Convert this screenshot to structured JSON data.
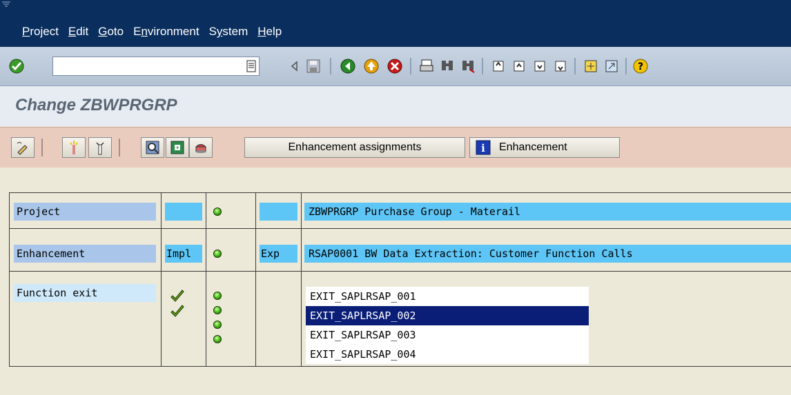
{
  "menu": {
    "items": [
      {
        "u": "P",
        "rest": "roject"
      },
      {
        "u": "E",
        "rest": "dit"
      },
      {
        "u": "G",
        "rest": "oto"
      },
      {
        "u": "",
        "rest": "E",
        "u2": "n",
        "rest2": "vironment"
      },
      {
        "u": "",
        "rest": "S",
        "u2": "y",
        "rest2": "stem"
      },
      {
        "u": "H",
        "rest": "elp"
      }
    ]
  },
  "toolbar": {
    "command_field_value": "",
    "icons": [
      "enter-icon",
      "history-icon",
      "back-arrow-icon",
      "save-icon",
      "back-icon",
      "exit-icon",
      "cancel-icon",
      "print-icon",
      "find-icon",
      "find-next-icon",
      "first-page-icon",
      "previous-page-icon",
      "next-page-icon",
      "last-page-icon",
      "create-session-icon",
      "shortcut-icon",
      "help-icon"
    ]
  },
  "title": "Change ZBWPRGRP",
  "app_toolbar": {
    "enhancement_assignments_label": "Enhancement assignments",
    "enhancement_label": "Enhancement",
    "icons": [
      "display-change-icon",
      "activate-icon",
      "deactivate-icon",
      "where-used-icon",
      "check-icon",
      "documentation-icon"
    ]
  },
  "rows": {
    "project": {
      "label": "Project",
      "impl": "",
      "exp": "",
      "text": "ZBWPRGRP Purchase Group - Materail"
    },
    "enhancement": {
      "label": "Enhancement",
      "impl": "Impl",
      "exp": "Exp",
      "text": "RSAP0001 BW Data Extraction: Customer Function Calls"
    },
    "function_exit": {
      "label": "Function exit",
      "exits": [
        "EXIT_SAPLRSAP_001",
        "EXIT_SAPLRSAP_002",
        "EXIT_SAPLRSAP_003",
        "EXIT_SAPLRSAP_004"
      ],
      "selected_index": 1,
      "implemented": [
        true,
        true,
        false,
        false
      ]
    }
  },
  "colors": {
    "menubar": "#0a2e5e",
    "selection": "#0a1e78",
    "status_light": "#4cc21a",
    "app_toolbar": "#eaccbf"
  }
}
